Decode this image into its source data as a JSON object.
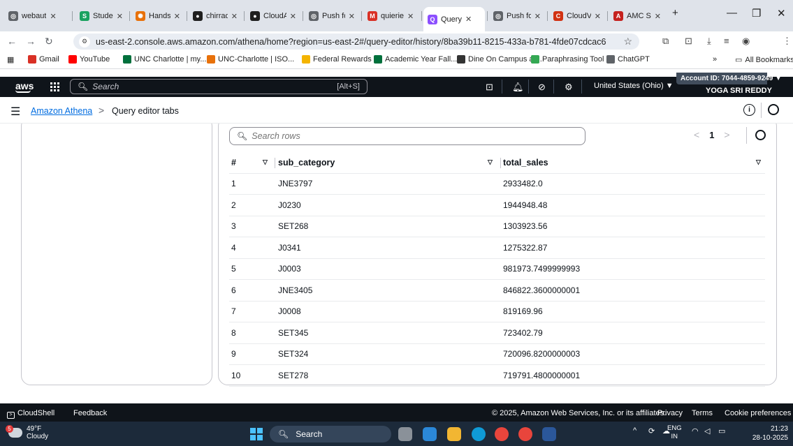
{
  "browser": {
    "tabs": [
      {
        "label": "webaut",
        "color": "#5f6368",
        "glyph": "◎"
      },
      {
        "label": "Studen",
        "color": "#1aa260",
        "glyph": "S"
      },
      {
        "label": "Hands",
        "color": "#e8710a",
        "glyph": "✺"
      },
      {
        "label": "chirrad",
        "color": "#1f1f1f",
        "glyph": "●"
      },
      {
        "label": "CloudA",
        "color": "#1f1f1f",
        "glyph": "●"
      },
      {
        "label": "Push fo",
        "color": "#5f6368",
        "glyph": "◎"
      },
      {
        "label": "quierie",
        "color": "#d93025",
        "glyph": "M"
      },
      {
        "label": "Query",
        "color": "#8c4fff",
        "glyph": "Q"
      },
      {
        "label": "Push fo",
        "color": "#5f6368",
        "glyph": "◎"
      },
      {
        "label": "CloudV",
        "color": "#d13212",
        "glyph": "C"
      },
      {
        "label": "AMC S",
        "color": "#c5221f",
        "glyph": "A"
      }
    ],
    "active_tab_index": 7,
    "url": "us-east-2.console.aws.amazon.com/athena/home?region=us-east-2#/query-editor/history/8ba39b11-8215-433a-b781-4fde07cdcac6",
    "bookmarks": [
      {
        "label": "Gmail",
        "color": "#d93025"
      },
      {
        "label": "YouTube",
        "color": "#ff0000"
      },
      {
        "label": "UNC Charlotte | my....",
        "color": "#00703c"
      },
      {
        "label": "UNC-Charlotte | ISO...",
        "color": "#e8710a"
      },
      {
        "label": "Federal Rewards",
        "color": "#f4b400"
      },
      {
        "label": "Academic Year Fall...",
        "color": "#00703c"
      },
      {
        "label": "Dine On Campus at...",
        "color": "#333333"
      },
      {
        "label": "Paraphrasing Tool (...",
        "color": "#34a853"
      },
      {
        "label": "ChatGPT",
        "color": "#5f6368"
      }
    ],
    "all_bookmarks": "All Bookmarks",
    "more_bookmarks": "»"
  },
  "aws": {
    "logo": "aws",
    "search_placeholder": "Search",
    "search_shortcut": "[Alt+S]",
    "region": "United States (Ohio) ▼",
    "account": "Account ID: 7044-4859-9249 ▼",
    "user": "YOGA SRI REDDY"
  },
  "breadcrumb": {
    "service": "Amazon Athena",
    "separator": ">",
    "current": "Query editor tabs"
  },
  "results": {
    "search_placeholder": "Search rows",
    "page": "1",
    "columns": [
      "#",
      "sub_category",
      "total_sales"
    ],
    "rows": [
      [
        "1",
        "JNE3797",
        "2933482.0"
      ],
      [
        "2",
        "J0230",
        "1944948.48"
      ],
      [
        "3",
        "SET268",
        "1303923.56"
      ],
      [
        "4",
        "J0341",
        "1275322.87"
      ],
      [
        "5",
        "J0003",
        "981973.7499999993"
      ],
      [
        "6",
        "JNE3405",
        "846822.3600000001"
      ],
      [
        "7",
        "J0008",
        "819169.96"
      ],
      [
        "8",
        "SET345",
        "723402.79"
      ],
      [
        "9",
        "SET324",
        "720096.8200000003"
      ],
      [
        "10",
        "SET278",
        "719791.4800000001"
      ]
    ]
  },
  "footer": {
    "cloudshell": "CloudShell",
    "feedback": "Feedback",
    "copyright": "© 2025, Amazon Web Services, Inc. or its affiliates.",
    "privacy": "Privacy",
    "terms": "Terms",
    "cookies": "Cookie preferences"
  },
  "taskbar": {
    "weather_badge": "5",
    "temperature": "49°F",
    "condition": "Cloudy",
    "search": "Search",
    "lang_top": "ENG",
    "lang_bottom": "IN",
    "time": "21:23",
    "date": "28-10-2025"
  }
}
